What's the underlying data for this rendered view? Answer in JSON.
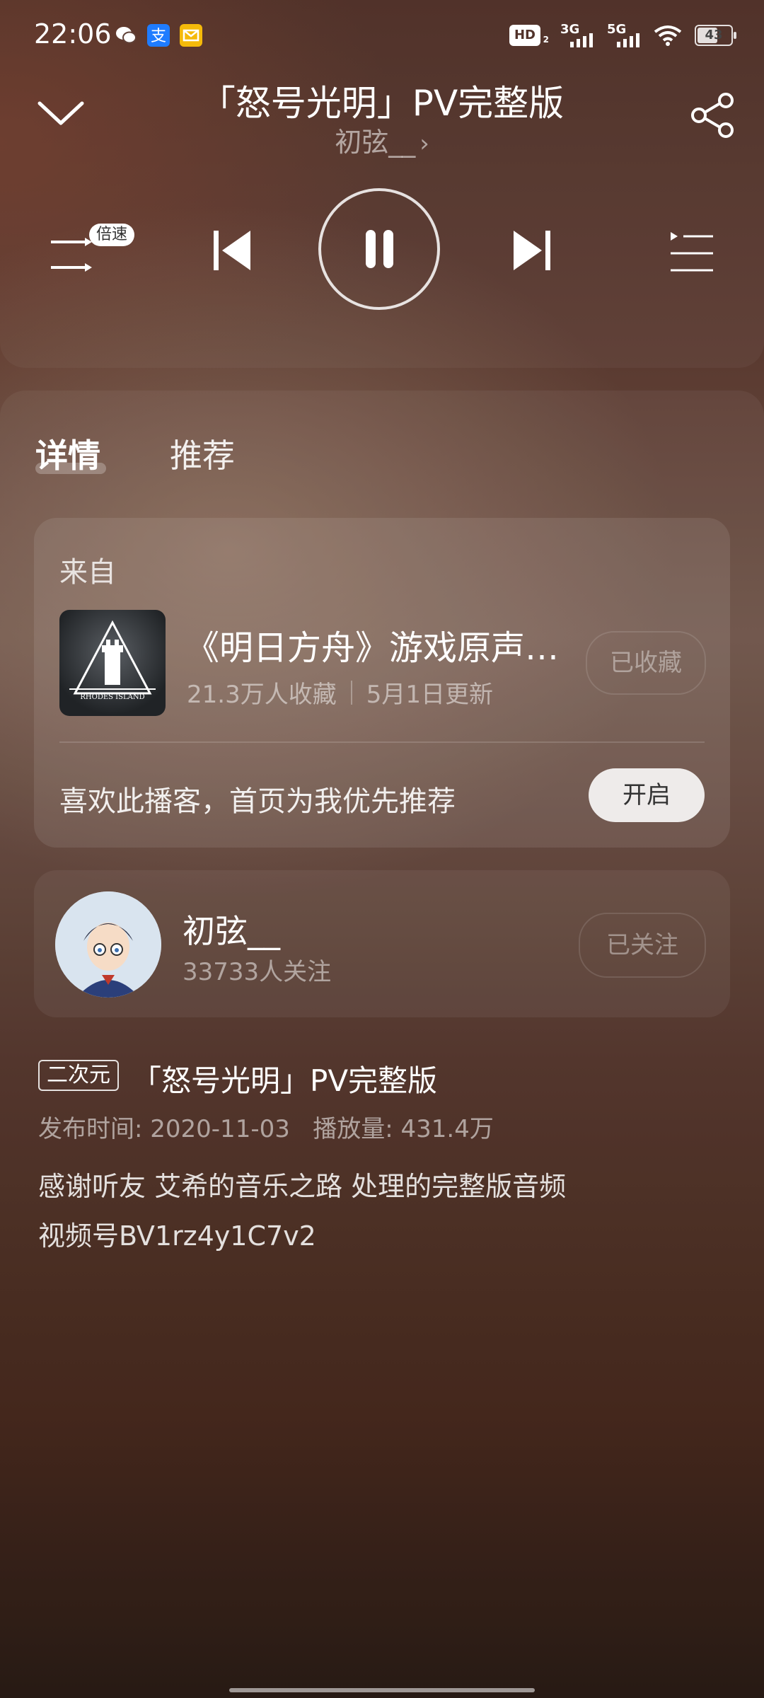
{
  "status_bar": {
    "time": "22:06",
    "hd_label": "HD",
    "hd_sub": "2",
    "net1": "3G",
    "net2": "5G",
    "battery": "43",
    "app_icons": [
      "wechat-icon",
      "alipay-icon",
      "mail-icon"
    ]
  },
  "player": {
    "title": "「怒号光明」PV完整版",
    "author": "初弦__",
    "speed_badge": "倍速",
    "accent_color": "#ffffff"
  },
  "tabs": [
    {
      "label": "详情",
      "active": true
    },
    {
      "label": "推荐",
      "active": false
    }
  ],
  "source_card": {
    "from_label": "来自",
    "album_title": "《明日方舟》游戏原声…",
    "collects": "21.3万人收藏",
    "updated": "5月1日更新",
    "collect_button": "已收藏",
    "recommend_text": "喜欢此播客，首页为我优先推荐",
    "enable_button": "开启"
  },
  "author_card": {
    "name": "初弦__",
    "followers": "33733人关注",
    "follow_button": "已关注"
  },
  "episode": {
    "category": "二次元",
    "title": "「怒号光明」PV完整版",
    "publish_info": "发布时间: 2020-11-03   播放量: 431.4万",
    "description_lines": [
      "感谢听友 艾希的音乐之路 处理的完整版音频",
      "视频号BV1rz4y1C7v2"
    ]
  }
}
